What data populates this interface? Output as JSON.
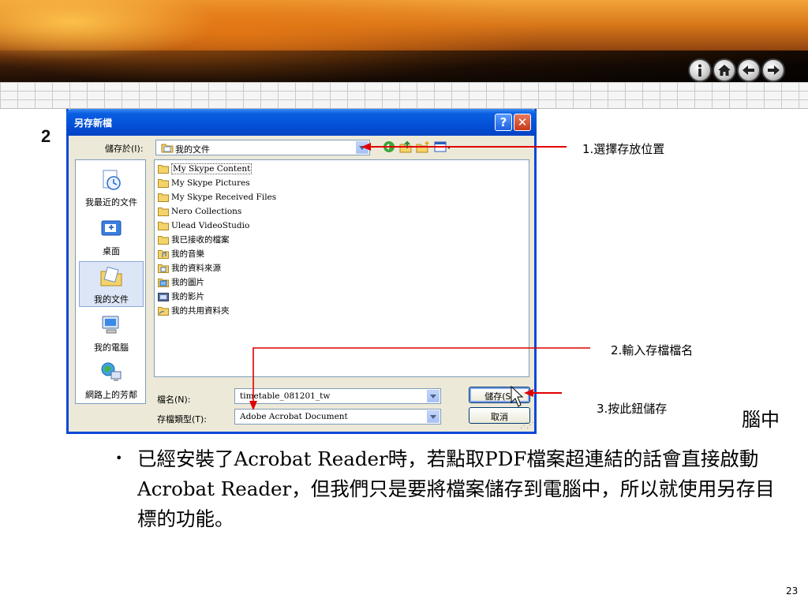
{
  "slide": {
    "step_number": "2",
    "partial_text": "腦中",
    "bullet_text": "已經安裝了Acrobat Reader時，若點取PDF檔案超連結的話會直接啟動Acrobat Reader，但我們只是要將檔案儲存到電腦中，所以就使用另存目標的功能。",
    "page_number": "23",
    "nav_icons": [
      "info-icon",
      "home-icon",
      "back-icon",
      "forward-icon"
    ]
  },
  "dialog": {
    "title": "另存新檔",
    "save_in_label": "儲存於(I):",
    "save_in_value": "我的文件",
    "places": [
      {
        "label": "我最近的文件",
        "icon": "recent-documents-icon"
      },
      {
        "label": "桌面",
        "icon": "desktop-icon"
      },
      {
        "label": "我的文件",
        "icon": "my-documents-icon",
        "selected": true
      },
      {
        "label": "我的電腦",
        "icon": "my-computer-icon"
      },
      {
        "label": "網路上的芳鄰",
        "icon": "network-places-icon"
      }
    ],
    "files": [
      {
        "name": "My Skype Content",
        "icon": "folder-icon"
      },
      {
        "name": "My Skype Pictures",
        "icon": "folder-icon"
      },
      {
        "name": "My Skype Received Files",
        "icon": "folder-icon"
      },
      {
        "name": "Nero Collections",
        "icon": "folder-icon"
      },
      {
        "name": "Ulead VideoStudio",
        "icon": "folder-icon"
      },
      {
        "name": "我已接收的檔案",
        "icon": "folder-icon"
      },
      {
        "name": "我的音樂",
        "icon": "music-folder-icon"
      },
      {
        "name": "我的資料來源",
        "icon": "data-sources-folder-icon"
      },
      {
        "name": "我的圖片",
        "icon": "pictures-folder-icon"
      },
      {
        "name": "我的影片",
        "icon": "videos-folder-icon"
      },
      {
        "name": "我的共用資料夾",
        "icon": "shared-folder-icon"
      }
    ],
    "filename_label": "檔名(N):",
    "filename_value": "timetable_081201_tw",
    "filetype_label": "存檔類型(T):",
    "filetype_value": "Adobe Acrobat Document",
    "save_button": "儲存(S)",
    "cancel_button": "取消"
  },
  "annotations": {
    "step1": "1.選擇存放位置",
    "step2": "2.輸入存檔檔名",
    "step3": "3.按此鈕儲存",
    "arrow_color": "#e00000"
  }
}
